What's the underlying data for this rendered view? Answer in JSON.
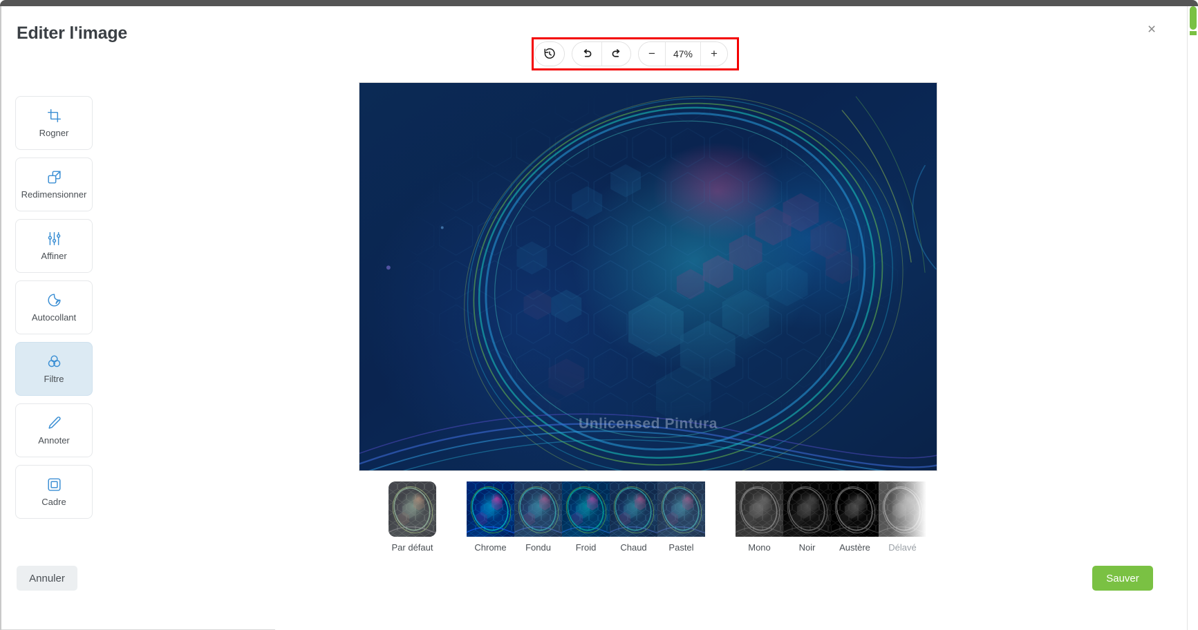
{
  "window": {
    "title": "Editer l'image",
    "close_label": "×"
  },
  "toolbar": {
    "highlighted": true,
    "highlight_color": "#f40000",
    "revert_label": "revert-icon",
    "undo_label": "undo-icon",
    "redo_label": "redo-icon",
    "zoom_out_label": "−",
    "zoom_value": "47%",
    "zoom_in_label": "+"
  },
  "sidebar": {
    "items": [
      {
        "label": "Rogner",
        "icon": "crop-icon",
        "active": false
      },
      {
        "label": "Redimensionner",
        "icon": "resize-icon",
        "active": false
      },
      {
        "label": "Affiner",
        "icon": "sliders-icon",
        "active": false
      },
      {
        "label": "Autocollant",
        "icon": "sticker-icon",
        "active": false
      },
      {
        "label": "Filtre",
        "icon": "filter-icon",
        "active": true
      },
      {
        "label": "Annoter",
        "icon": "pencil-icon",
        "active": false
      },
      {
        "label": "Cadre",
        "icon": "frame-icon",
        "active": false
      }
    ]
  },
  "canvas": {
    "watermark": "Unlicensed Pintura",
    "background_color": "#0b2a55"
  },
  "filters": {
    "groups": [
      {
        "name": "default",
        "items": [
          {
            "label": "Par défaut",
            "fx": "fx-default",
            "standalone": true,
            "clipped": false
          }
        ]
      },
      {
        "name": "color",
        "items": [
          {
            "label": "Chrome",
            "fx": "fx-chrome",
            "standalone": false,
            "clipped": false
          },
          {
            "label": "Fondu",
            "fx": "fx-fade",
            "standalone": false,
            "clipped": false
          },
          {
            "label": "Froid",
            "fx": "fx-cold",
            "standalone": false,
            "clipped": false
          },
          {
            "label": "Chaud",
            "fx": "fx-warm",
            "standalone": false,
            "clipped": false
          },
          {
            "label": "Pastel",
            "fx": "fx-pastel",
            "standalone": false,
            "clipped": false
          }
        ]
      },
      {
        "name": "monochrome",
        "items": [
          {
            "label": "Mono",
            "fx": "fx-mono",
            "standalone": false,
            "clipped": false
          },
          {
            "label": "Noir",
            "fx": "fx-noir",
            "standalone": false,
            "clipped": false
          },
          {
            "label": "Austère",
            "fx": "fx-stark",
            "standalone": false,
            "clipped": false
          },
          {
            "label": "Délavé",
            "fx": "fx-washed",
            "standalone": false,
            "clipped": true
          }
        ]
      }
    ]
  },
  "footer": {
    "cancel_label": "Annuler",
    "save_label": "Sauver",
    "save_color": "#7ac143"
  }
}
